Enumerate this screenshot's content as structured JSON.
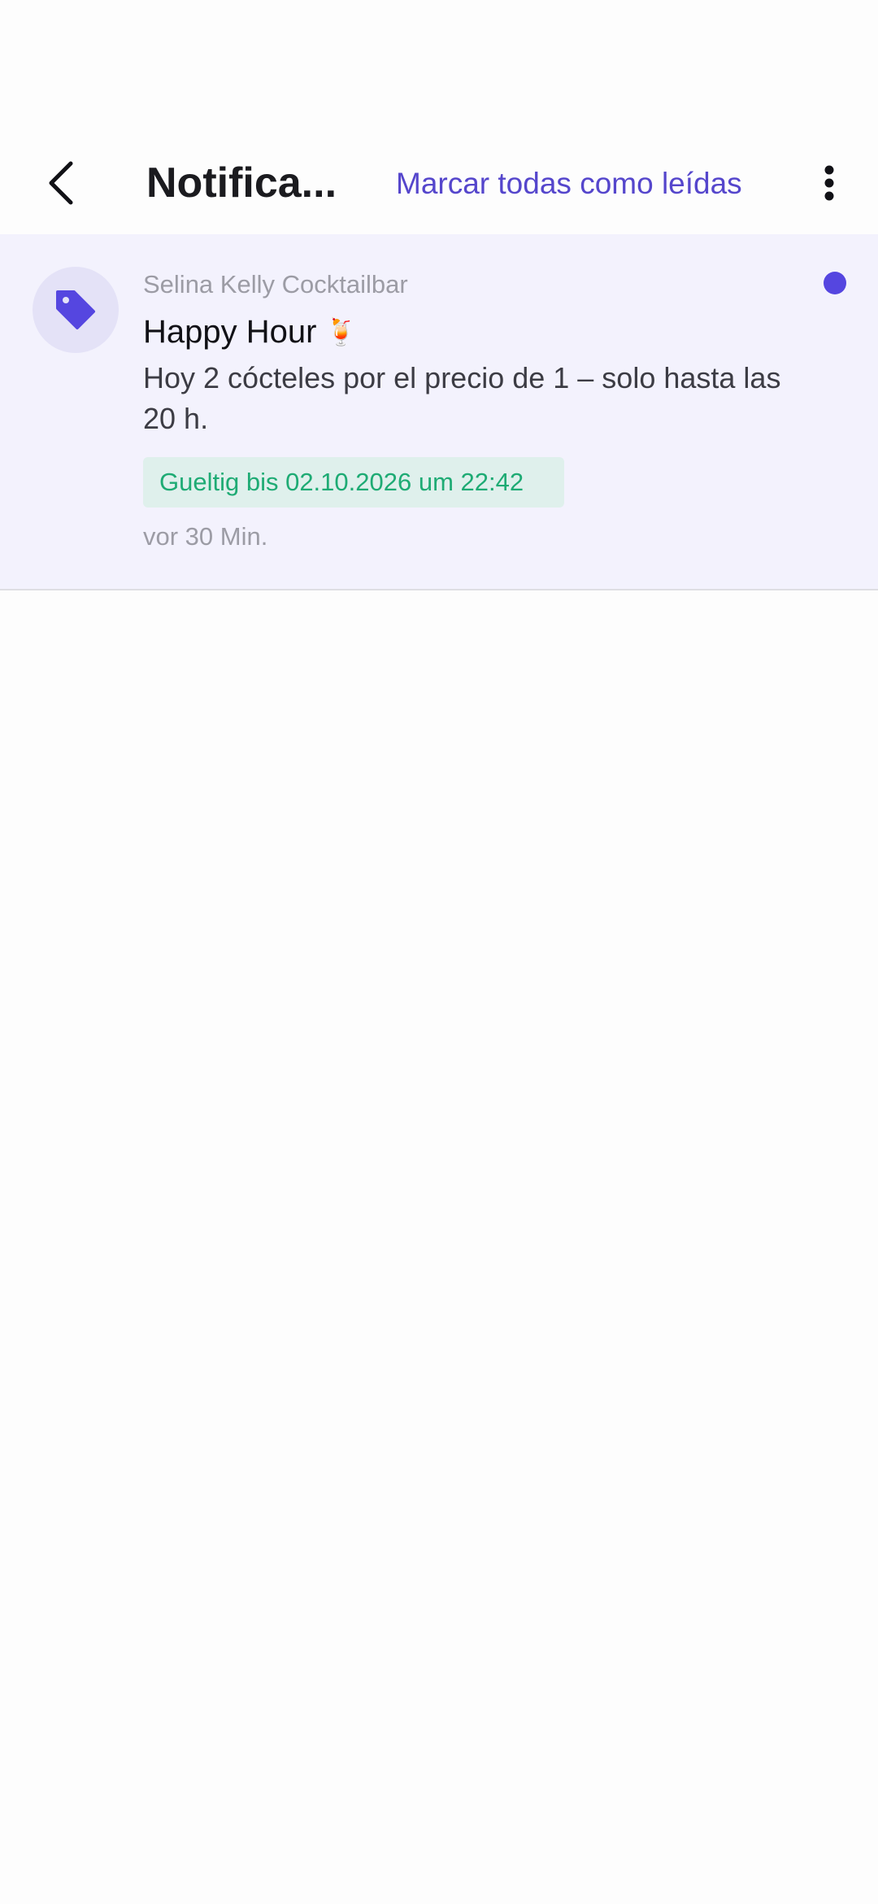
{
  "header": {
    "title": "Notifica...",
    "mark_all_read": "Marcar todas como leídas",
    "back_icon": "chevron-left-icon",
    "more_icon": "more-vertical-icon"
  },
  "notifications": [
    {
      "icon": "tag-icon",
      "sender": "Selina Kelly Cocktailbar",
      "title": "Happy Hour",
      "title_emoji": "🍹",
      "body": "Hoy 2 cócteles por el precio de 1 – solo hasta las 20 h.",
      "validity": "Gueltig bis 02.10.2026 um 22:42",
      "time": "vor 30 Min.",
      "unread": true
    }
  ],
  "colors": {
    "accent": "#5546cc",
    "unread_background": "#f3f2fd",
    "badge_background": "#dff0ec",
    "badge_text": "#1eab74"
  }
}
